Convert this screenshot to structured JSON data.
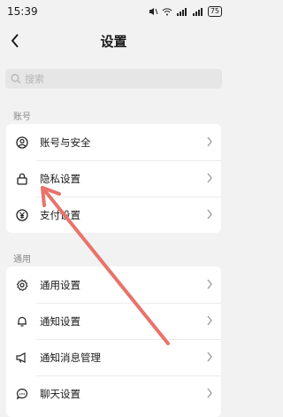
{
  "status_bar": {
    "time": "15:39",
    "signal": "📶",
    "battery": "75"
  },
  "nav": {
    "title": "设置"
  },
  "search": {
    "placeholder": "搜索"
  },
  "sections": [
    {
      "label": "账号",
      "items": [
        {
          "label": "账号与安全",
          "icon": "user-shield-icon"
        },
        {
          "label": "隐私设置",
          "icon": "lock-icon"
        },
        {
          "label": "支付设置",
          "icon": "yen-icon"
        }
      ]
    },
    {
      "label": "通用",
      "items": [
        {
          "label": "通用设置",
          "icon": "gear-icon"
        },
        {
          "label": "通知设置",
          "icon": "bell-icon"
        },
        {
          "label": "通知消息管理",
          "icon": "megaphone-icon"
        },
        {
          "label": "聊天设置",
          "icon": "chat-bubble-icon"
        }
      ]
    }
  ],
  "colors": {
    "annotation_arrow": "#e8736b"
  }
}
